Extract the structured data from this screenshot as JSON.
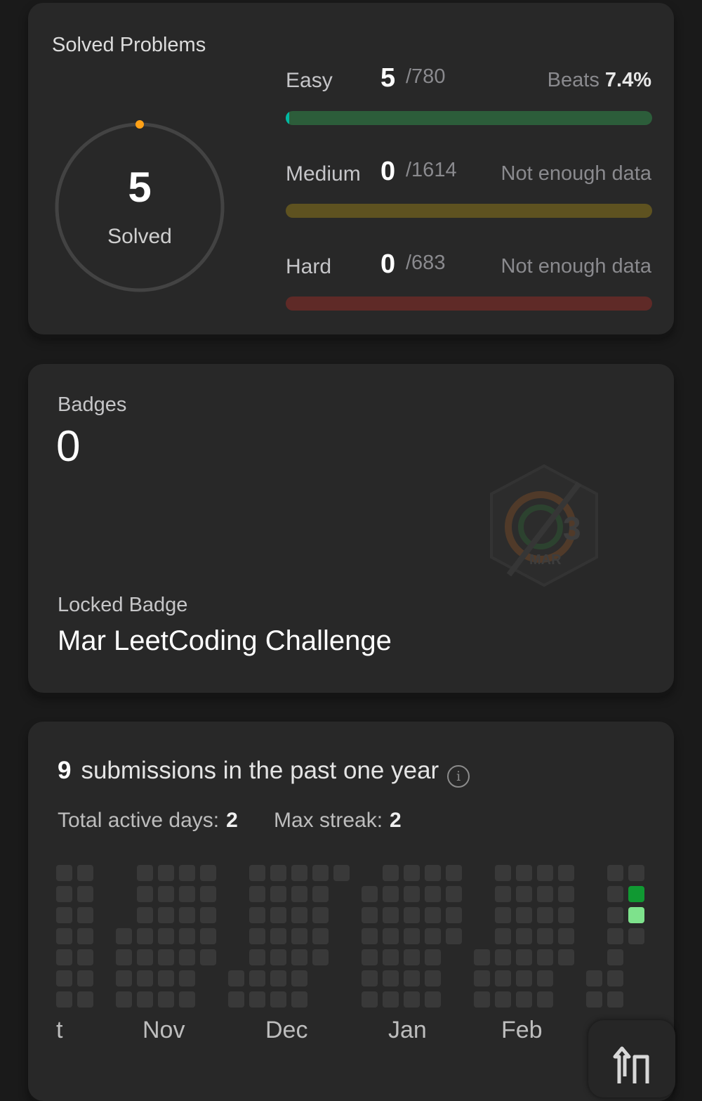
{
  "solved": {
    "title": "Solved Problems",
    "count": "5",
    "count_label": "Solved",
    "difficulties": [
      {
        "name": "Easy",
        "solved": "5",
        "total": "/780",
        "beats_label": "Beats",
        "beats_value": "7.4%",
        "note": "",
        "progress": 0.0064,
        "track_color": "#2c5d3a",
        "fill_color": "#00b8a3"
      },
      {
        "name": "Medium",
        "solved": "0",
        "total": "/1614",
        "beats_label": "",
        "beats_value": "",
        "note": "Not enough data",
        "progress": 0,
        "track_color": "#5e5220",
        "fill_color": "#ffc01e"
      },
      {
        "name": "Hard",
        "solved": "0",
        "total": "/683",
        "beats_label": "",
        "beats_value": "",
        "note": "Not enough data",
        "progress": 0,
        "track_color": "#5f2a27",
        "fill_color": "#ef4743"
      }
    ]
  },
  "badges": {
    "label": "Badges",
    "count": "0",
    "locked_label": "Locked Badge",
    "locked_name": "Mar LeetCoding Challenge",
    "emblem_text_number": "3",
    "emblem_text_month": "MAR"
  },
  "submissions": {
    "count": "9",
    "heading": "submissions in the past one year",
    "active_days_label": "Total active days:",
    "active_days": "2",
    "max_streak_label": "Max streak:",
    "max_streak": "2",
    "months": [
      "t",
      "Nov",
      "Dec",
      "Jan",
      "Feb"
    ],
    "colors": {
      "empty": "#393939",
      "level2": "#109932",
      "level1": "#7ee28c"
    }
  },
  "icons": {
    "info": "info-icon",
    "share": "share-icon"
  },
  "info_glyph": "i"
}
